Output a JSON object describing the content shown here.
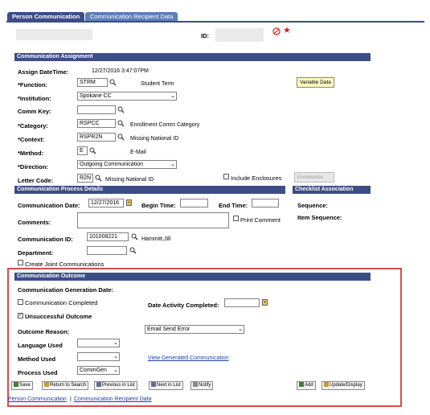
{
  "tabs": [
    {
      "label": "Person Communication"
    },
    {
      "label": "Communication Recipient Data"
    }
  ],
  "header": {
    "id_label": "ID:"
  },
  "assignment": {
    "section_title": "Communication Assignment",
    "assign_datetime_label": "Assign DateTime:",
    "assign_datetime_value": "12/27/2016  3:47:07PM",
    "function_label": "*Function:",
    "function_value": "STRM",
    "function_desc": "Student Term",
    "variable_data_button": "Variable Data",
    "institution_label": "*Institution:",
    "institution_value": "Spokane CC",
    "comm_key_label": "Comm Key:",
    "comm_key_value": "",
    "category_label": "*Category:",
    "category_value": "RSPCC",
    "category_desc": "Enrollment Comm Category",
    "context_label": "*Context:",
    "context_value": "RSPR2N",
    "context_desc": "Missing National ID",
    "method_label": "*Method:",
    "method_value": "E",
    "method_desc": "E-Mail",
    "direction_label": "*Direction:",
    "direction_value": "Outgoing Communication",
    "letter_code_label": "Letter Code:",
    "letter_code_value": "R2N",
    "letter_code_desc": "Missing National ID",
    "include_enclosures_label": "Include Enclosures",
    "enclosures_button": "Enclosures"
  },
  "process": {
    "section_title": "Communication Process Details",
    "comm_date_label": "Communication Date:",
    "comm_date_value": "12/27/2016",
    "begin_time_label": "Begin Time:",
    "end_time_label": "End Time:",
    "comments_label": "Comments:",
    "print_comment_label": "Print Comment",
    "comm_id_label": "Communication ID:",
    "comm_id_value": "101008221",
    "comm_id_name": "Hammitt,Jill",
    "department_label": "Department:",
    "create_joint_label": "Create Joint Communications"
  },
  "checklist": {
    "section_title": "Checklist Association",
    "sequence_label": "Sequence:",
    "item_sequence_label": "Item Sequence:"
  },
  "outcome": {
    "section_title": "Communication Outcome",
    "generation_date_label": "Communication Generation Date:",
    "completed_label": "Communication Completed",
    "date_activity_label": "Date Activity Completed:",
    "unsuccessful_label": "Unsuccessful Outcome",
    "outcome_reason_label": "Outcome Reason:",
    "outcome_reason_value": "Email Send Error",
    "language_label": "Language Used",
    "method_used_label": "Method Used",
    "view_generated_link": "View Generated Communication",
    "process_used_label": "Process Used",
    "process_used_value": "CommGen"
  },
  "toolbar": {
    "save": "Save",
    "return_search": "Return to Search",
    "prev_list": "Previous in List",
    "next_list": "Next in List",
    "notify": "Notify",
    "add": "Add",
    "update_display": "Update/Display"
  },
  "footer": {
    "link1": "Person Communication",
    "separator": "|",
    "link2": "Communication Recipient Data"
  },
  "colors": {
    "section_header": "#3c4e86",
    "highlight_border": "#d84a4a",
    "link": "#1a3ea8",
    "button_bg": "#fafac4"
  }
}
